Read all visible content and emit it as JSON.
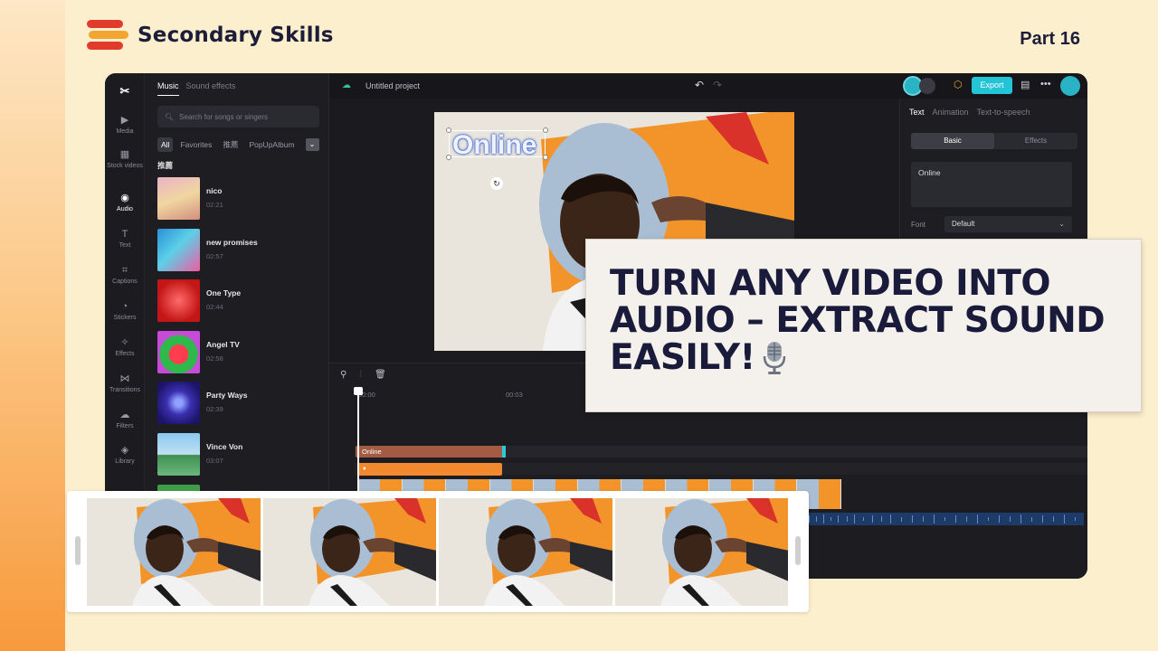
{
  "brand": {
    "name": "Secondary Skills",
    "part": "Part 16",
    "colors": {
      "logo_red": "#e23a2b",
      "logo_orange": "#f3a531",
      "text": "#1d1d3a"
    }
  },
  "editor": {
    "rail": [
      {
        "label": "Media",
        "icon": "media-icon"
      },
      {
        "label": "Stock videos",
        "icon": "stock-icon"
      },
      {
        "label": "Audio",
        "icon": "audio-icon",
        "active": true
      },
      {
        "label": "Text",
        "icon": "text-icon"
      },
      {
        "label": "Captions",
        "icon": "captions-icon"
      },
      {
        "label": "Stickers",
        "icon": "stickers-icon"
      },
      {
        "label": "Effects",
        "icon": "effects-icon"
      },
      {
        "label": "Transitions",
        "icon": "transitions-icon"
      },
      {
        "label": "Filters",
        "icon": "filters-icon"
      },
      {
        "label": "Library",
        "icon": "library-icon"
      }
    ],
    "panel": {
      "tabs": [
        "Music",
        "Sound effects"
      ],
      "search_placeholder": "Search for songs or singers",
      "filters": [
        "All",
        "Favorites",
        "推薦",
        "PopUpAlbum"
      ],
      "section": "推薦",
      "tracks": [
        {
          "title": "nico",
          "duration": "02:21"
        },
        {
          "title": "new promises",
          "duration": "02:57"
        },
        {
          "title": "One Type",
          "duration": "02:44"
        },
        {
          "title": "Angel TV",
          "duration": "02:58"
        },
        {
          "title": "Party Ways",
          "duration": "02:39"
        },
        {
          "title": "Vince Von",
          "duration": "03:07"
        }
      ]
    },
    "topbar": {
      "project": "Untitled project",
      "export": "Export"
    },
    "canvas": {
      "overlay_text": "Online"
    },
    "right_panel": {
      "tabs": [
        "Text",
        "Animation",
        "Text-to-speech"
      ],
      "segments": [
        "Basic",
        "Effects"
      ],
      "text_value": "Online",
      "font_label": "Font",
      "font_value": "Default"
    },
    "timeline": {
      "ticks": [
        "00:00",
        "00:03"
      ],
      "text_clip": "Online"
    }
  },
  "headline": "TURN ANY VIDEO INTO AUDIO – EXTRACT SOUND EASILY!"
}
